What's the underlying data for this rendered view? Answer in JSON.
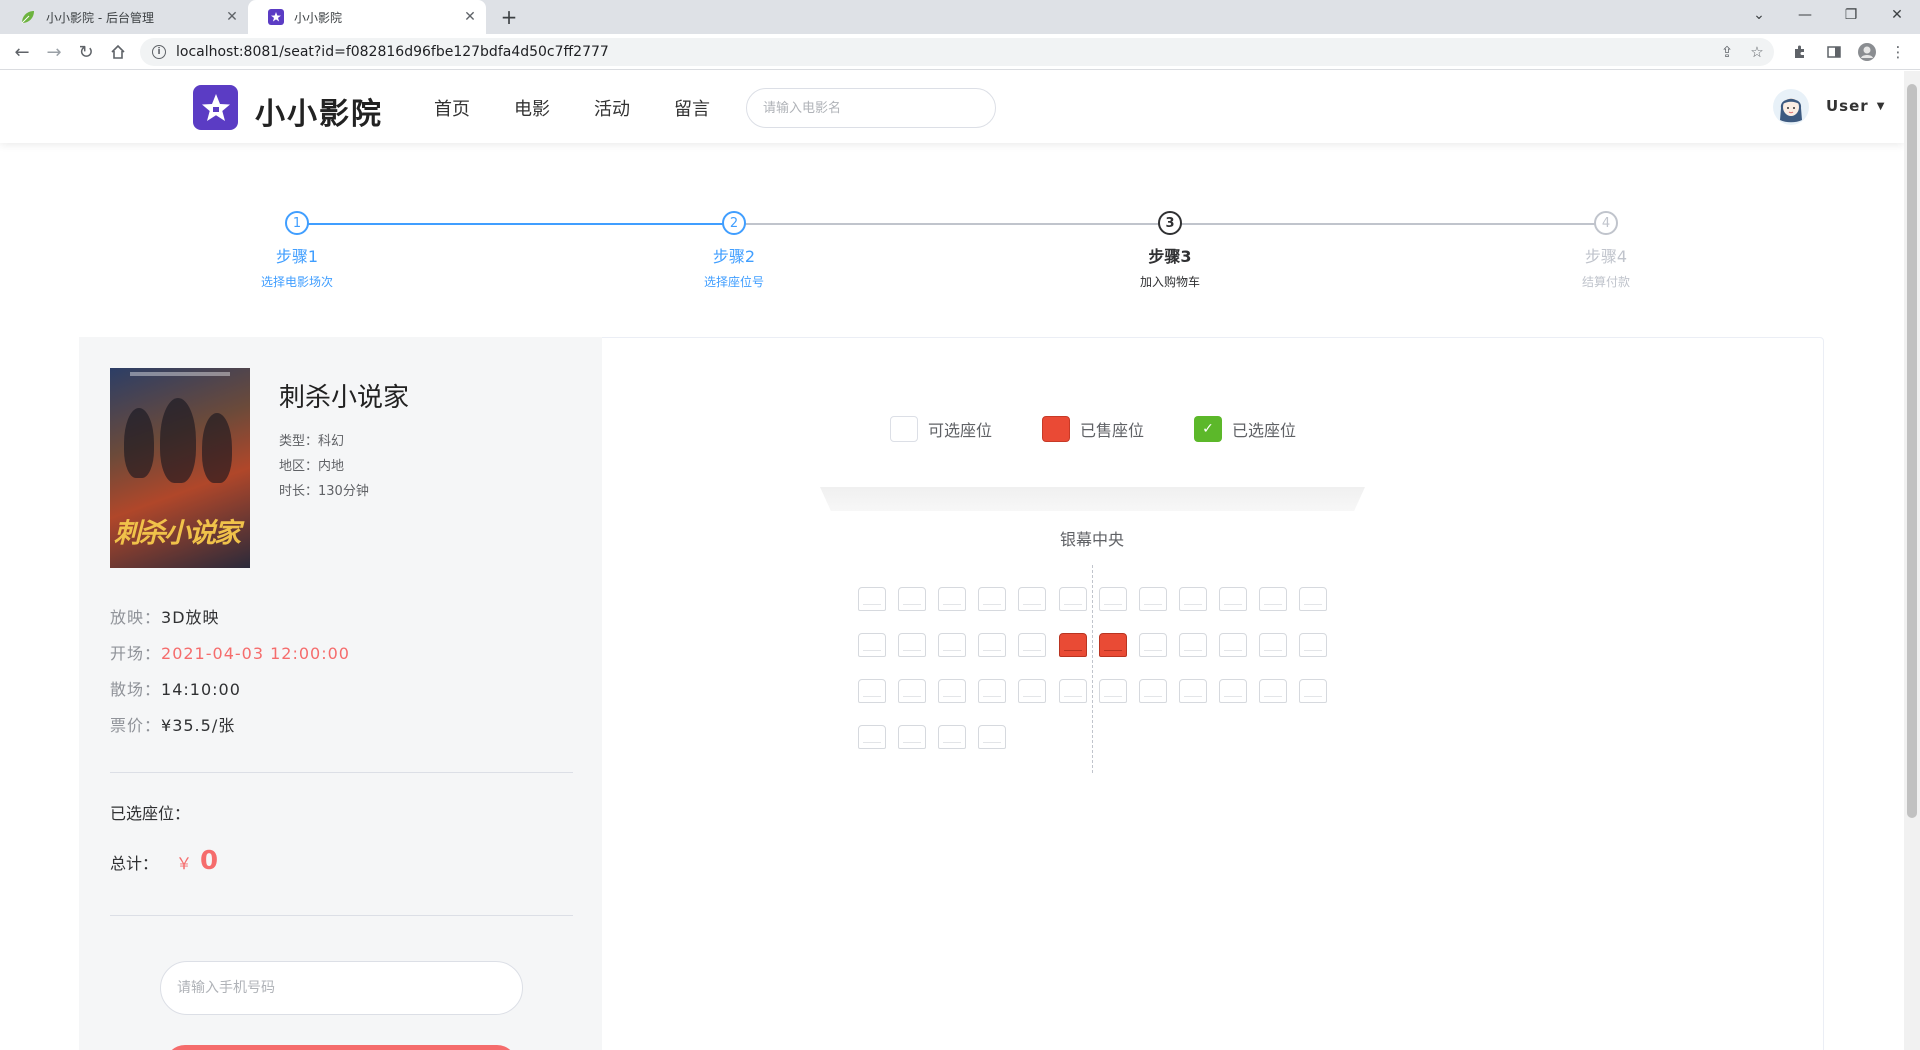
{
  "browser": {
    "tabs": [
      {
        "title": "小小影院 - 后台管理",
        "active": false,
        "icon": "leaf-icon"
      },
      {
        "title": "小小影院",
        "active": true,
        "icon": "star-icon"
      }
    ],
    "url": "localhost:8081/seat?id=f082816d96fbe127bdfa4d50c7ff2777"
  },
  "header": {
    "logo_text": "小小影院",
    "nav": [
      "首页",
      "电影",
      "活动",
      "留言"
    ],
    "search_placeholder": "请输入电影名",
    "user_label": "User"
  },
  "steps": [
    {
      "title": "步骤1",
      "desc": "选择电影场次",
      "num": "1",
      "state": "done"
    },
    {
      "title": "步骤2",
      "desc": "选择座位号",
      "num": "2",
      "state": "done"
    },
    {
      "title": "步骤3",
      "desc": "加入购物车",
      "num": "3",
      "state": "active"
    },
    {
      "title": "步骤4",
      "desc": "结算付款",
      "num": "4",
      "state": "wait"
    }
  ],
  "movie": {
    "title": "刺杀小说家",
    "poster_text": "刺杀小说家",
    "genre": "类型：科幻",
    "region": "地区：内地",
    "duration": "时长：130分钟",
    "format_label": "放映：",
    "format_value": "3D放映",
    "start_label": "开场：",
    "start_value": "2021-04-03 12:00:00",
    "end_label": "散场：",
    "end_value": "14:10:00",
    "price_label": "票价：",
    "price_value": "¥35.5/张"
  },
  "order": {
    "selected_label": "已选座位：",
    "total_label": "总计：",
    "currency": "￥",
    "total_amount": "0",
    "phone_placeholder": "请输入手机号码"
  },
  "legend": {
    "available": "可选座位",
    "sold": "已售座位",
    "selected": "已选座位"
  },
  "screen_label": "银幕中央",
  "seats": {
    "rows": [
      [
        "a",
        "a",
        "a",
        "a",
        "a",
        "a",
        "a",
        "a",
        "a",
        "a",
        "a",
        "a"
      ],
      [
        "a",
        "a",
        "a",
        "a",
        "a",
        "s",
        "s",
        "a",
        "a",
        "a",
        "a",
        "a"
      ],
      [
        "a",
        "a",
        "a",
        "a",
        "a",
        "a",
        "a",
        "a",
        "a",
        "a",
        "a",
        "a"
      ],
      [
        "a",
        "a",
        "a",
        "a"
      ]
    ]
  },
  "colors": {
    "primary": "#409eff",
    "sold": "#e94b35",
    "selected": "#5cb82a",
    "price_red": "#f56c6c",
    "logo_purple": "#5b3cc4"
  }
}
